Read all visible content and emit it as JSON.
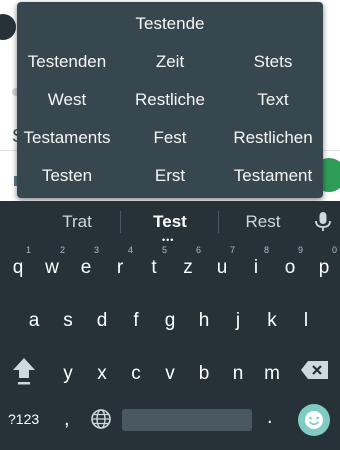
{
  "background": {
    "partial_letter": "S"
  },
  "popup": {
    "top_word": "Testende",
    "rows": [
      [
        "Testenden",
        "Zeit",
        "Stets"
      ],
      [
        "West",
        "Restliche",
        "Text"
      ],
      [
        "Testaments",
        "Fest",
        "Restlichen"
      ],
      [
        "Testen",
        "Erst",
        "Testament"
      ]
    ]
  },
  "suggestions": {
    "left": "Trat",
    "middle": "Test",
    "right": "Rest",
    "more_dots": "•••"
  },
  "keys": {
    "row1": [
      {
        "k": "q",
        "n": "1"
      },
      {
        "k": "w",
        "n": "2"
      },
      {
        "k": "e",
        "n": "3"
      },
      {
        "k": "r",
        "n": "4"
      },
      {
        "k": "t",
        "n": "5"
      },
      {
        "k": "z",
        "n": "6"
      },
      {
        "k": "u",
        "n": "7"
      },
      {
        "k": "i",
        "n": "8"
      },
      {
        "k": "o",
        "n": "9"
      },
      {
        "k": "p",
        "n": "0"
      }
    ],
    "row2": [
      "a",
      "s",
      "d",
      "f",
      "g",
      "h",
      "j",
      "k",
      "l"
    ],
    "row3": [
      "y",
      "x",
      "c",
      "v",
      "b",
      "n",
      "m"
    ],
    "bottom": {
      "symbols": "?123",
      "comma": ",",
      "period": "."
    }
  },
  "colors": {
    "keyboard_bg": "#263238",
    "popup_bg": "#37474f",
    "emoji_accent": "#80cbc4"
  },
  "icons": [
    "mic-icon",
    "shift-icon",
    "backspace-icon",
    "globe-icon",
    "emoji-icon"
  ]
}
